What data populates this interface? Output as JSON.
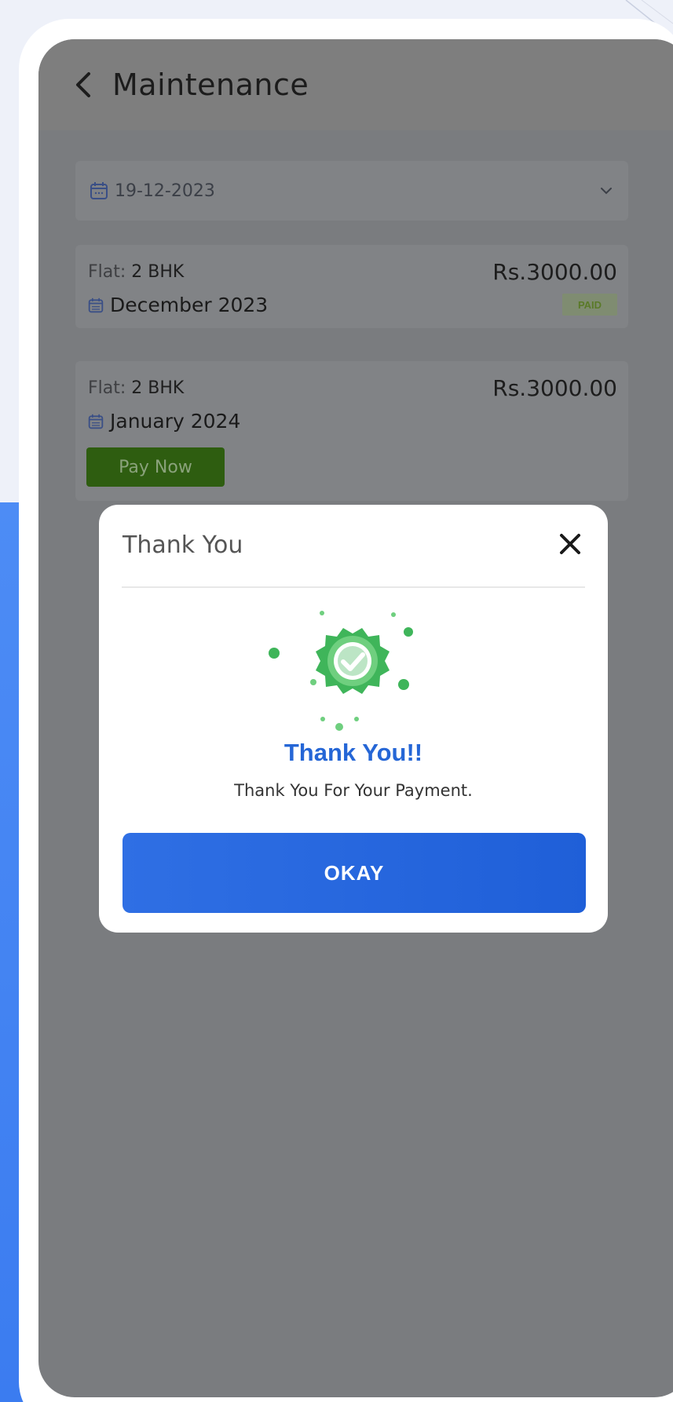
{
  "header": {
    "title": "Maintenance"
  },
  "filter": {
    "date": "19-12-2023"
  },
  "bills": [
    {
      "flat_label": "Flat:",
      "flat_value": "2 BHK",
      "amount": "Rs.3000.00",
      "month": "December 2023",
      "status": "PAID"
    },
    {
      "flat_label": "Flat:",
      "flat_value": "2 BHK",
      "amount": "Rs.3000.00",
      "month": "January 2024",
      "action": "Pay Now"
    }
  ],
  "dialog": {
    "title": "Thank You",
    "heading": "Thank You!!",
    "message": "Thank You For Your Payment.",
    "button": "OKAY"
  },
  "colors": {
    "primary": "#2566d6",
    "success": "#3fb55a",
    "pay_button": "#2e5d10",
    "overlay": "#7a7c7f"
  },
  "icons": {
    "back": "chevron-left-icon",
    "calendar": "calendar-icon",
    "dropdown": "chevron-down-icon",
    "close": "close-icon",
    "success": "verified-badge-icon"
  }
}
